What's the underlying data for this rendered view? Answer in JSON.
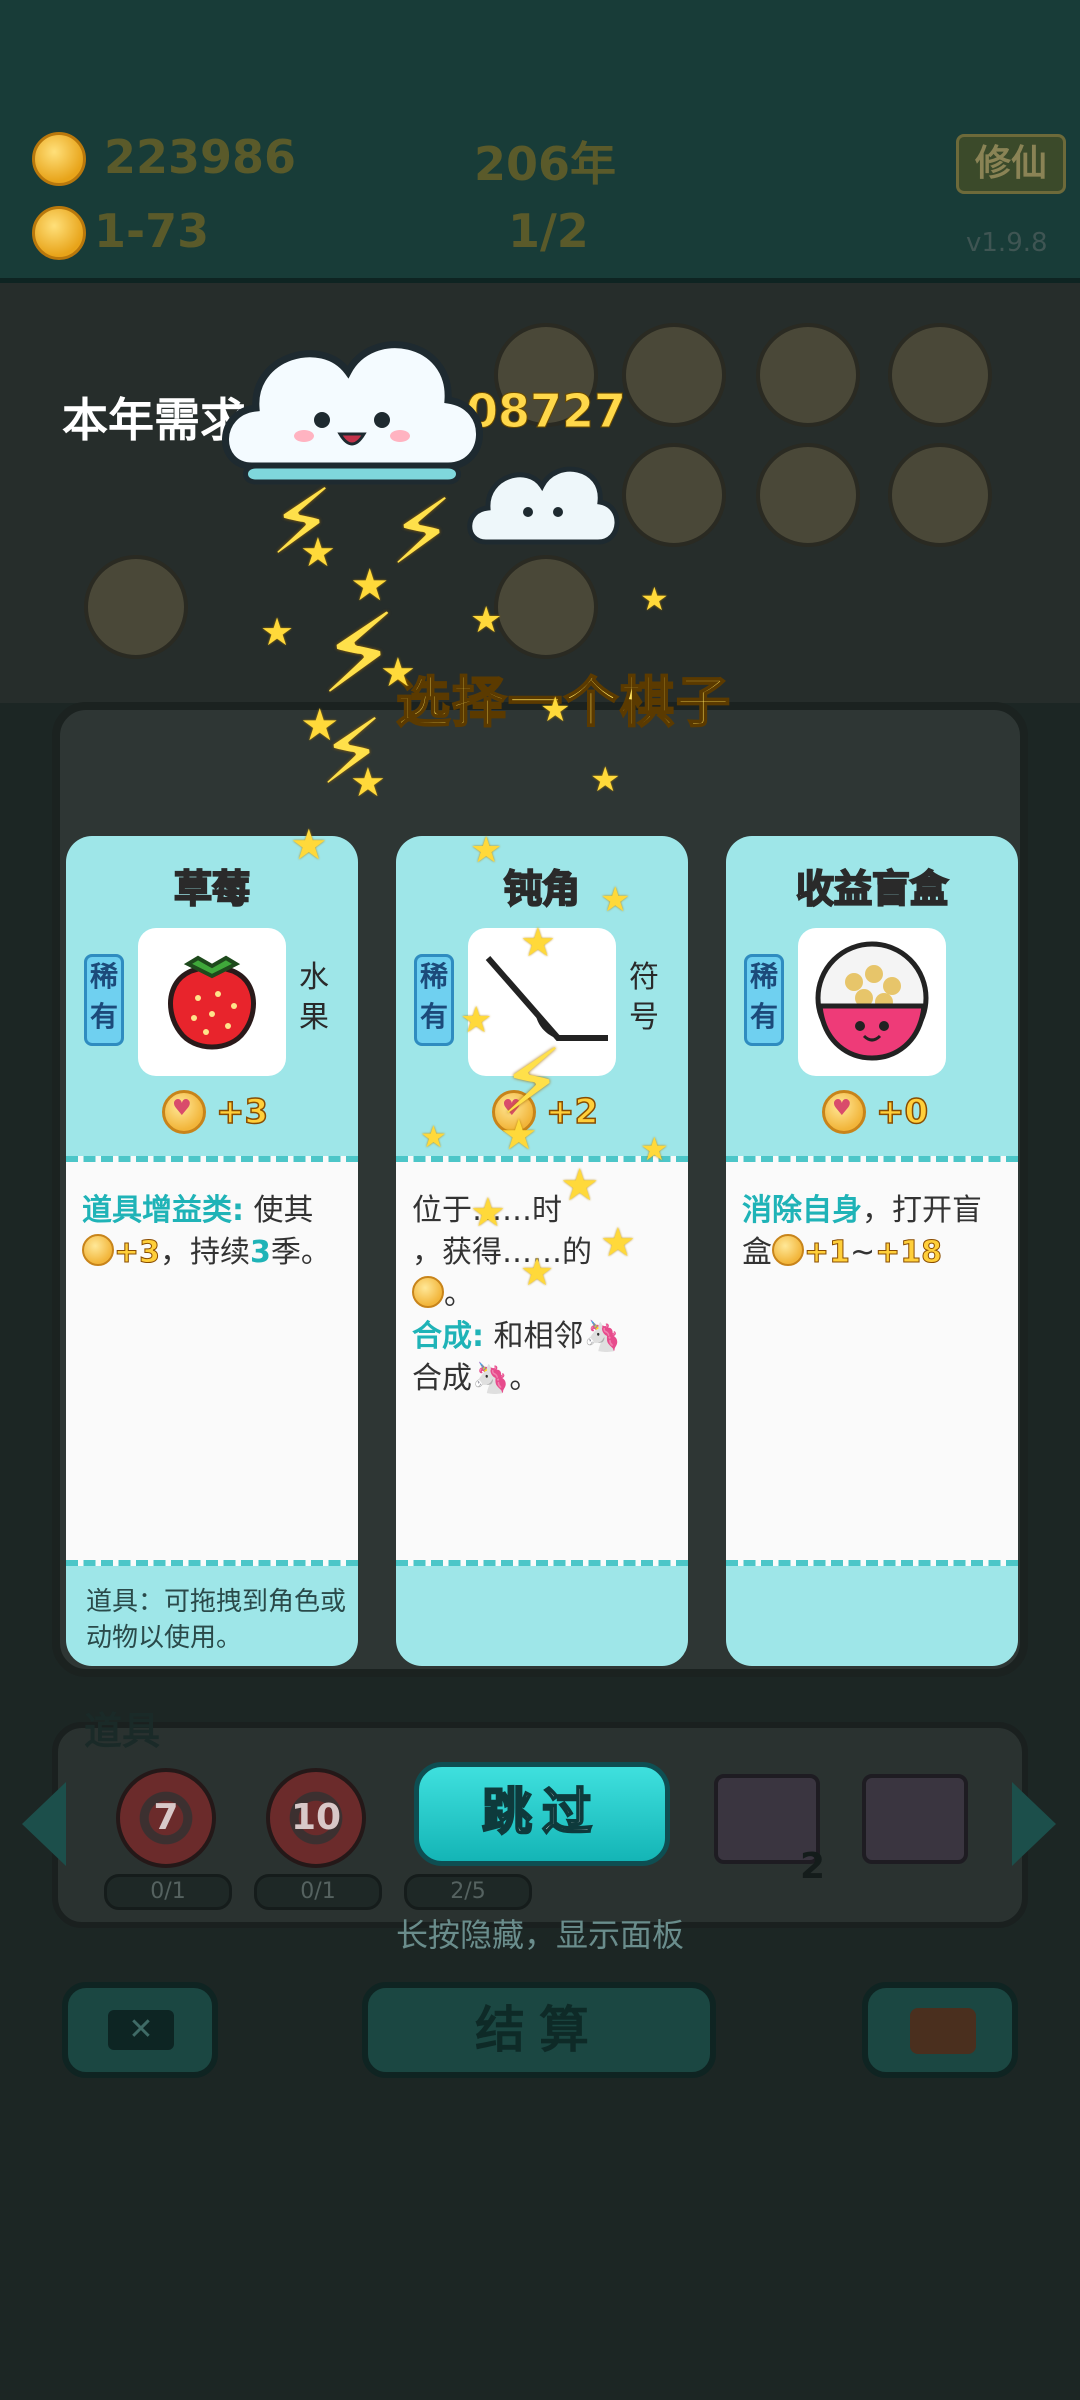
{
  "header": {
    "coins": "223986",
    "year": "206年",
    "per_turn": "1-73",
    "progress": "1/2",
    "cultivate_label": "修仙",
    "version": "v1.9.8"
  },
  "overlay": {
    "year_requirement_label": "本年需求",
    "year_requirement_value": "08727",
    "choose_title": "选择一个棋子"
  },
  "cards": [
    {
      "name": "草莓",
      "rarity": "稀有",
      "category": "水果",
      "picture_icon": "strawberry-icon",
      "income": "+3",
      "desc_keyword": "道具增益类:",
      "desc_text_1": " 使其",
      "desc_value": "+3",
      "desc_text_2": "，持续",
      "desc_duration": "3",
      "desc_text_3": "季。",
      "footnote": "道具：可拖拽到角色或动物以使用。"
    },
    {
      "name": "钝角",
      "rarity": "稀有",
      "category": "符号",
      "picture_icon": "obtuse-angle-icon",
      "income": "+2",
      "desc_line_1": "位于……时",
      "desc_line_2": "，获得……的",
      "desc_line_3": "。",
      "merge_keyword": "合成:",
      "merge_text_1": " 和相邻",
      "merge_text_2": "合成",
      "merge_text_3": "。"
    },
    {
      "name": "收益盲盒",
      "rarity": "稀有",
      "category": "",
      "picture_icon": "mystery-bowl-icon",
      "income": "+0",
      "desc_keyword": "消除自身",
      "desc_text_1": "，打开盲盒",
      "desc_range_low": "+1",
      "desc_range_sep": "~",
      "desc_range_high": "+18"
    }
  ],
  "tray": {
    "title": "道具",
    "items": [
      {
        "label": "7",
        "count": "0/1"
      },
      {
        "label": "10",
        "count": "0/1"
      },
      {
        "label": "",
        "count": "2/5"
      }
    ],
    "machine_count": "2"
  },
  "actions": {
    "skip_label": "跳过",
    "hide_hint": "长按隐藏，显示面板",
    "settle_label": "结算"
  },
  "colors": {
    "card_bg": "#9ee6e8",
    "accent_teal": "#1fb3b7",
    "gold": "#ffcf3a"
  }
}
